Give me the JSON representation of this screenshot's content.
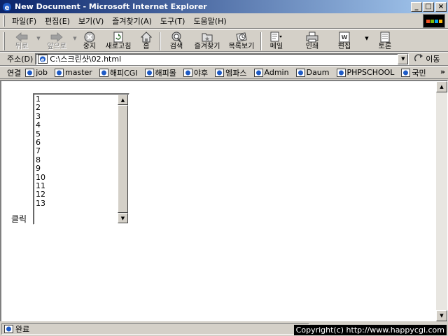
{
  "window": {
    "title": "New Document - Microsoft Internet Explorer",
    "minimize": "_",
    "maximize": "□",
    "close": "×"
  },
  "menubar": {
    "items": [
      "파일(F)",
      "편집(E)",
      "보기(V)",
      "즐겨찾기(A)",
      "도구(T)",
      "도움말(H)"
    ]
  },
  "toolbar": {
    "back": "뒤로",
    "forward": "앞으로",
    "stop": "중지",
    "refresh": "새로고침",
    "home": "홈",
    "search": "검색",
    "favorites": "즐겨찾기",
    "history": "목록보기",
    "mail": "메일",
    "print": "인쇄",
    "edit": "편집",
    "discuss": "토론"
  },
  "address": {
    "label": "주소(D)",
    "url": "C:\\스크린샷\\02.html",
    "go": "이동"
  },
  "links": {
    "label": "연결",
    "items": [
      "job",
      "master",
      "해피CGI",
      "해피몰",
      "야후",
      "엠파스",
      "Admin",
      "Daum",
      "PHPSCHOOL",
      "국민"
    ],
    "more": "»"
  },
  "page": {
    "click_label": "클릭",
    "list_items": [
      "1",
      "2",
      "3",
      "4",
      "5",
      "6",
      "7",
      "8",
      "9",
      "10",
      "11",
      "12",
      "13"
    ]
  },
  "status": {
    "text": "완료",
    "overlay": "Copyright(c) http://www.happycgi.com"
  },
  "colors": {
    "title_gradient_start": "#0a246a",
    "title_gradient_end": "#a6caf0",
    "chrome": "#d4d0c8",
    "ie_icon": "#1e5bc6"
  }
}
